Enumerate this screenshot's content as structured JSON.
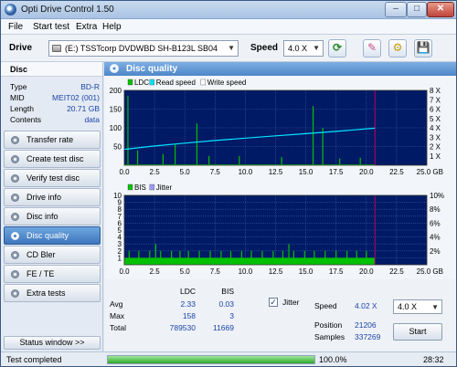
{
  "window": {
    "title": "Opti Drive Control 1.50",
    "min_glyph": "–",
    "max_glyph": "□",
    "close_glyph": "✕"
  },
  "menu": [
    "File",
    "Start test",
    "Extra",
    "Help"
  ],
  "toolbar": {
    "drive_label": "Drive",
    "drive_value": "(E:)  TSSTcorp DVDWBD SH-B123L SB04",
    "speed_label": "Speed",
    "speed_value": "4.0 X",
    "icons": [
      "refresh-icon",
      "erase-icon",
      "config-icon",
      "save-icon"
    ],
    "refresh_glyph": "⟳",
    "erase_glyph": "✎",
    "config_glyph": "⚙",
    "save_glyph": "💾"
  },
  "disc": {
    "header": "Disc",
    "info": [
      {
        "label": "Type",
        "value": "BD-R"
      },
      {
        "label": "MID",
        "value": "MEIT02 (001)"
      },
      {
        "label": "Length",
        "value": "20.71 GB"
      },
      {
        "label": "Contents",
        "value": "data"
      }
    ]
  },
  "nav": [
    {
      "label": "Transfer rate",
      "active": false
    },
    {
      "label": "Create test disc",
      "active": false
    },
    {
      "label": "Verify test disc",
      "active": false
    },
    {
      "label": "Drive info",
      "active": false
    },
    {
      "label": "Disc info",
      "active": false
    },
    {
      "label": "Disc quality",
      "active": true
    },
    {
      "label": "CD Bler",
      "active": false
    },
    {
      "label": "FE / TE",
      "active": false
    },
    {
      "label": "Extra tests",
      "active": false
    }
  ],
  "status_window_button": "Status window >>",
  "main": {
    "title": "Disc quality"
  },
  "chart_data": [
    {
      "type": "bar",
      "legend": [
        "LDC",
        "Read speed",
        "Write speed"
      ],
      "colors": {
        "ldc": "#00c000",
        "read_speed": "#00e5ff",
        "write_speed": "#ffffff",
        "background": "#001a66",
        "grid": "#3e5fa0",
        "end_marker": "#c00060"
      },
      "x_ticks": [
        "0.0",
        "2.5",
        "5.0",
        "7.5",
        "10.0",
        "12.5",
        "15.0",
        "17.5",
        "20.0",
        "22.5",
        "25.0 GB"
      ],
      "y_ticks_left": [
        "200",
        "150",
        "100",
        "50"
      ],
      "y_ticks_right": [
        "8 X",
        "7 X",
        "6 X",
        "5 X",
        "4 X",
        "3 X",
        "2 X",
        "1 X"
      ],
      "xlim": [
        0,
        25
      ],
      "ylim": [
        0,
        200
      ],
      "y2lim": [
        0,
        8
      ],
      "disc_end_gb": 20.71,
      "ldc_baseline": 2.3,
      "ldc_spikes": [
        {
          "x": 0.3,
          "y": 186
        },
        {
          "x": 1.1,
          "y": 40
        },
        {
          "x": 3.2,
          "y": 30
        },
        {
          "x": 4.2,
          "y": 55
        },
        {
          "x": 6.0,
          "y": 112
        },
        {
          "x": 7.0,
          "y": 25
        },
        {
          "x": 9.5,
          "y": 25
        },
        {
          "x": 13.0,
          "y": 22
        },
        {
          "x": 15.6,
          "y": 158
        },
        {
          "x": 16.4,
          "y": 100
        },
        {
          "x": 17.8,
          "y": 18
        },
        {
          "x": 19.5,
          "y": 20
        }
      ],
      "read_speed": [
        {
          "x": 0.0,
          "y": 1.7
        },
        {
          "x": 2.5,
          "y": 2.06
        },
        {
          "x": 5.0,
          "y": 2.36
        },
        {
          "x": 7.5,
          "y": 2.64
        },
        {
          "x": 10.0,
          "y": 2.9
        },
        {
          "x": 12.5,
          "y": 3.14
        },
        {
          "x": 15.0,
          "y": 3.38
        },
        {
          "x": 17.5,
          "y": 3.62
        },
        {
          "x": 20.71,
          "y": 3.96
        }
      ]
    },
    {
      "type": "bar",
      "legend": [
        "BIS",
        "Jitter"
      ],
      "colors": {
        "bis": "#00c000",
        "jitter": "#9a9aff",
        "background": "#001a66",
        "grid": "#3e5fa0",
        "end_marker": "#c00060"
      },
      "x_ticks": [
        "0.0",
        "2.5",
        "5.0",
        "7.5",
        "10.0",
        "12.5",
        "15.0",
        "17.5",
        "20.0",
        "22.5",
        "25.0 GB"
      ],
      "y_ticks_left": [
        "10",
        "9",
        "8",
        "7",
        "6",
        "5",
        "4",
        "3",
        "2",
        "1"
      ],
      "y_ticks_right": [
        "10%",
        "8%",
        "6%",
        "4%",
        "2%"
      ],
      "xlim": [
        0,
        25
      ],
      "ylim": [
        0,
        10
      ],
      "disc_end_gb": 20.71,
      "bis_baseline": 1,
      "bis_spikes": [
        {
          "x": 0.4,
          "y": 2
        },
        {
          "x": 1.2,
          "y": 2
        },
        {
          "x": 2.1,
          "y": 2
        },
        {
          "x": 3.0,
          "y": 2
        },
        {
          "x": 3.9,
          "y": 2
        },
        {
          "x": 4.6,
          "y": 2
        },
        {
          "x": 5.3,
          "y": 2
        },
        {
          "x": 6.2,
          "y": 2
        },
        {
          "x": 7.1,
          "y": 2
        },
        {
          "x": 8.0,
          "y": 2
        },
        {
          "x": 8.8,
          "y": 2
        },
        {
          "x": 9.7,
          "y": 2
        },
        {
          "x": 10.5,
          "y": 2
        },
        {
          "x": 11.4,
          "y": 2
        },
        {
          "x": 12.3,
          "y": 2
        },
        {
          "x": 13.1,
          "y": 2
        },
        {
          "x": 14.0,
          "y": 2
        },
        {
          "x": 14.9,
          "y": 2
        },
        {
          "x": 15.7,
          "y": 2
        },
        {
          "x": 16.6,
          "y": 2
        },
        {
          "x": 17.5,
          "y": 2
        },
        {
          "x": 18.4,
          "y": 2
        },
        {
          "x": 19.2,
          "y": 2
        },
        {
          "x": 20.0,
          "y": 2
        },
        {
          "x": 2.6,
          "y": 3
        },
        {
          "x": 13.6,
          "y": 3
        }
      ]
    }
  ],
  "stats": {
    "col_ldc": "LDC",
    "col_bis": "BIS",
    "rows": [
      {
        "label": "Avg",
        "ldc": "2.33",
        "bis": "0.03"
      },
      {
        "label": "Max",
        "ldc": "158",
        "bis": "3"
      },
      {
        "label": "Total",
        "ldc": "789530",
        "bis": "11669"
      }
    ],
    "jitter_label": "Jitter",
    "jitter_checked": "✓",
    "speed_label": "Speed",
    "speed_value": "4.02 X",
    "speed_select": "4.0 X",
    "position_label": "Position",
    "position_value": "21206",
    "samples_label": "Samples",
    "samples_value": "337269",
    "start_button": "Start"
  },
  "status": {
    "text": "Test completed",
    "progress_percent": 100,
    "progress_label": "100.0%",
    "elapsed": "28:32"
  }
}
